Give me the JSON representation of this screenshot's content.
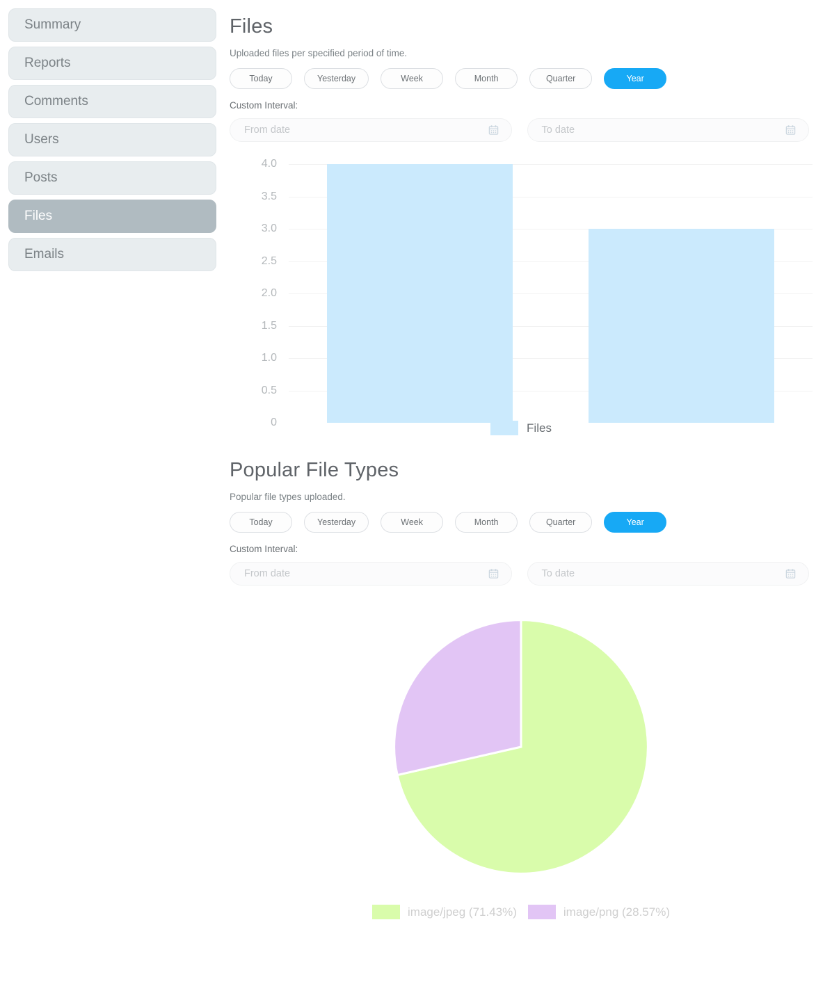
{
  "sidebar": {
    "items": [
      {
        "label": "Summary",
        "active": false
      },
      {
        "label": "Reports",
        "active": false
      },
      {
        "label": "Comments",
        "active": false
      },
      {
        "label": "Users",
        "active": false
      },
      {
        "label": "Posts",
        "active": false
      },
      {
        "label": "Files",
        "active": true
      },
      {
        "label": "Emails",
        "active": false
      }
    ]
  },
  "files_section": {
    "title": "Files",
    "subtitle": "Uploaded files per specified period of time.",
    "range_buttons": [
      {
        "label": "Today",
        "active": false
      },
      {
        "label": "Yesterday",
        "active": false
      },
      {
        "label": "Week",
        "active": false
      },
      {
        "label": "Month",
        "active": false
      },
      {
        "label": "Quarter",
        "active": false
      },
      {
        "label": "Year",
        "active": true
      }
    ],
    "custom_interval_label": "Custom Interval:",
    "from_date": {
      "value": "",
      "placeholder": "From date"
    },
    "to_date": {
      "value": "",
      "placeholder": "To date"
    }
  },
  "filetypes_section": {
    "title": "Popular File Types",
    "subtitle": "Popular file types uploaded.",
    "range_buttons": [
      {
        "label": "Today",
        "active": false
      },
      {
        "label": "Yesterday",
        "active": false
      },
      {
        "label": "Week",
        "active": false
      },
      {
        "label": "Month",
        "active": false
      },
      {
        "label": "Quarter",
        "active": false
      },
      {
        "label": "Year",
        "active": true
      }
    ],
    "custom_interval_label": "Custom Interval:",
    "from_date": {
      "value": "",
      "placeholder": "From date"
    },
    "to_date": {
      "value": "",
      "placeholder": "To date"
    }
  },
  "colors": {
    "accent_blue": "#17a9f5",
    "bar_blue": "#cbeafd",
    "pie_green": "#d9fcab",
    "pie_purple": "#e2c5f5",
    "sidebar_active": "#b0bbc1",
    "sidebar_idle": "#e8edef"
  },
  "chart_data": [
    {
      "type": "bar",
      "title": "Files",
      "xlabel": "",
      "ylabel": "",
      "categories": [
        "",
        ""
      ],
      "values": [
        4,
        3
      ],
      "ylim": [
        0,
        4
      ],
      "yticks": [
        "0",
        "0.5",
        "1.0",
        "1.5",
        "2.0",
        "2.5",
        "3.0",
        "3.5",
        "4.0"
      ],
      "grid": true,
      "legend": [
        {
          "name": "Files",
          "color": "#cbeafd"
        }
      ],
      "legend_position": "bottom"
    },
    {
      "type": "pie",
      "title": "Popular File Types",
      "labels": [
        "image/jpeg (71.43%)",
        "image/png (28.57%)"
      ],
      "values": [
        71.43,
        28.57
      ],
      "colors": [
        "#d9fcab",
        "#e2c5f5"
      ],
      "legend_position": "bottom"
    }
  ]
}
